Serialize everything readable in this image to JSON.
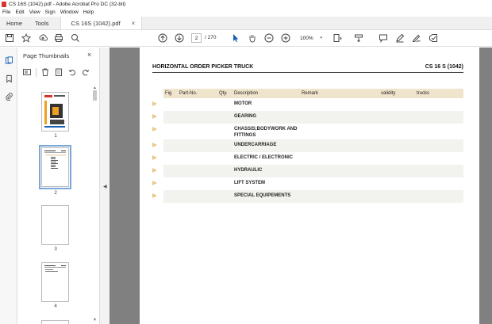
{
  "window": {
    "title": "CS 16S (1042).pdf - Adobe Acrobat Pro DC (32-bit)"
  },
  "menu": [
    "File",
    "Edit",
    "View",
    "Sign",
    "Window",
    "Help"
  ],
  "tabs": {
    "home": "Home",
    "tools": "Tools",
    "document": "CS 16S (1042).pdf",
    "close": "×"
  },
  "toolbar": {
    "current_page": "2",
    "total_pages": "/ 270",
    "zoom": "100%"
  },
  "thumbnails": {
    "header": "Page Thumbnails",
    "close": "×",
    "pages": [
      {
        "label": "1"
      },
      {
        "label": "2"
      },
      {
        "label": "3"
      },
      {
        "label": "4"
      }
    ]
  },
  "document": {
    "title": "HORIZONTAL ORDER PICKER TRUCK",
    "model": "CS 16 S (1042)",
    "columns": [
      "Fig",
      "Part-No.",
      "Qty.",
      "Description",
      "Remark",
      "validity",
      "trucks"
    ],
    "rows": [
      {
        "description": "MOTOR"
      },
      {
        "description": "GEARING"
      },
      {
        "description": "CHASSIS;BODYWORK AND FITTINGS"
      },
      {
        "description": "UNDERCARRIAGE"
      },
      {
        "description": "ELECTRIC / ELECTRONIC"
      },
      {
        "description": "HYDRAULIC"
      },
      {
        "description": "LIFT SYSTEM"
      },
      {
        "description": "SPECIAL EQUIPEMENTS"
      }
    ]
  },
  "colors": {
    "accent": "#d9342b",
    "table_header": "#f0e4cc",
    "row_marker": "#e8c98a"
  }
}
